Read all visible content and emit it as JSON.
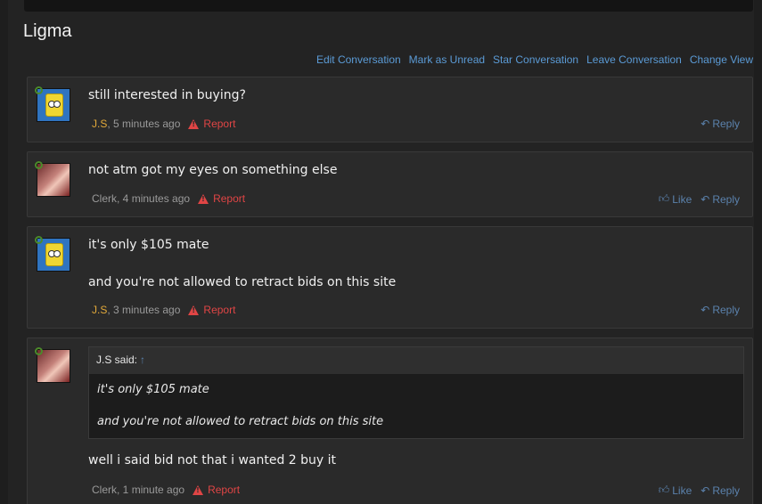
{
  "conversation_title": "Ligma",
  "actions": [
    "Edit Conversation",
    "Mark as Unread",
    "Star Conversation",
    "Leave Conversation",
    "Change View"
  ],
  "messages": [
    {
      "lines": [
        "still interested in buying?"
      ],
      "author": "J.S",
      "time": ", 5 minutes ago",
      "report": "Report",
      "like": "",
      "reply": "Reply"
    },
    {
      "lines": [
        "not atm got my eyes on something else"
      ],
      "author": "Clerk",
      "time": ", 4 minutes ago",
      "report": "Report",
      "like": "Like",
      "reply": "Reply"
    },
    {
      "lines": [
        "it's only $105 mate",
        "and you're not allowed to retract bids on this site"
      ],
      "author": "J.S",
      "time": ", 3 minutes ago",
      "report": "Report",
      "like": "",
      "reply": "Reply"
    },
    {
      "quote": {
        "author_said": "J.S said:",
        "lines": [
          "it's only $105 mate",
          "and you're not allowed to retract bids on this site"
        ]
      },
      "lines": [
        "well i said bid not that i wanted 2 buy it"
      ],
      "author": "Clerk",
      "time": ", 1 minute ago",
      "report": "Report",
      "like": "Like",
      "reply": "Reply"
    }
  ]
}
